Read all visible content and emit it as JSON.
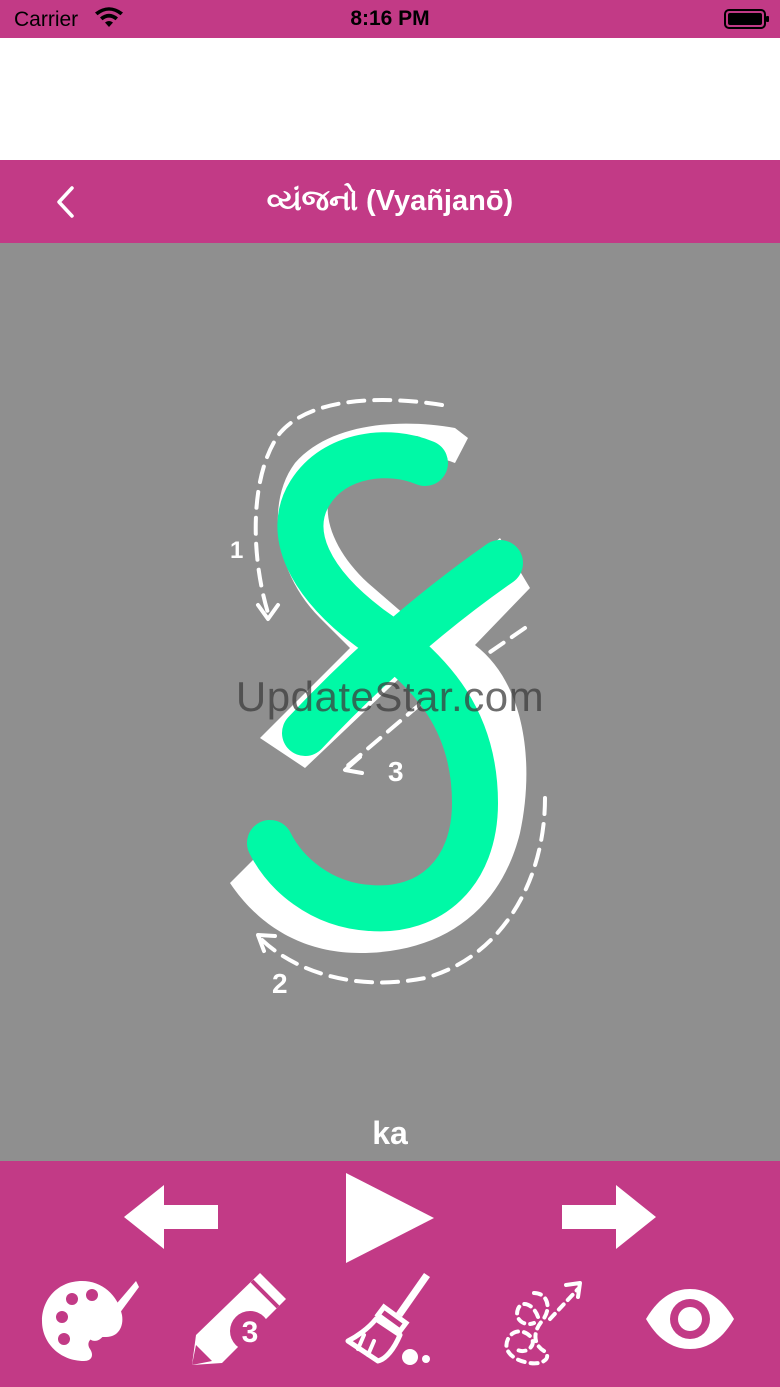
{
  "status_bar": {
    "carrier": "Carrier",
    "time": "8:16 PM"
  },
  "nav": {
    "title": "વ્યંજનો (Vyañjanō)",
    "back_icon": "chevron-left-icon"
  },
  "canvas": {
    "background_color": "#8f8f8f",
    "stroke_color": "#00f9a6",
    "watermark": "UpdateStar.com",
    "stroke_numbers": [
      "1",
      "2",
      "3"
    ],
    "letter_label": "ka"
  },
  "toolbar": {
    "background_color": "#c23a86",
    "icons": {
      "prev": "arrow-left-icon",
      "play": "play-icon",
      "next": "arrow-right-icon",
      "palette": "palette-icon",
      "pencil": "pencil-icon",
      "eraser": "broom-icon",
      "path": "dotted-path-icon",
      "eye": "eye-icon"
    },
    "pencil_badge": "3"
  }
}
